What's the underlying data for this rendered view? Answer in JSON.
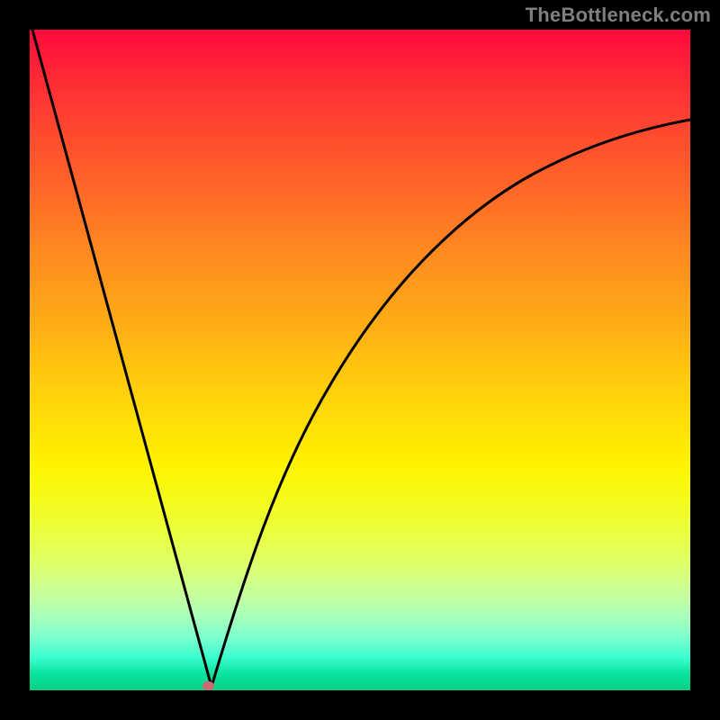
{
  "watermark": "TheBottleneck.com",
  "chart_data": {
    "type": "line",
    "title": "",
    "xlabel": "",
    "ylabel": "",
    "xlim": [
      0,
      100
    ],
    "ylim": [
      0,
      100
    ],
    "series": [
      {
        "name": "bottleneck-curve-left",
        "x": [
          0.5,
          27.5
        ],
        "values": [
          100,
          0.5
        ]
      },
      {
        "name": "bottleneck-curve-right",
        "x": [
          27.5,
          33,
          39,
          45,
          52,
          60,
          69,
          79,
          89,
          100
        ],
        "values": [
          0.5,
          20,
          36,
          48,
          58,
          66,
          73,
          78.5,
          82.8,
          86
        ]
      }
    ],
    "annotations": [
      {
        "name": "optimal-marker",
        "x": 26.7,
        "y": 0.6
      }
    ],
    "grid": false,
    "legend": false
  },
  "colors": {
    "background": "#000000",
    "curve": "#000000",
    "marker": "#cc6a6f",
    "watermark": "#7f7f7f"
  }
}
